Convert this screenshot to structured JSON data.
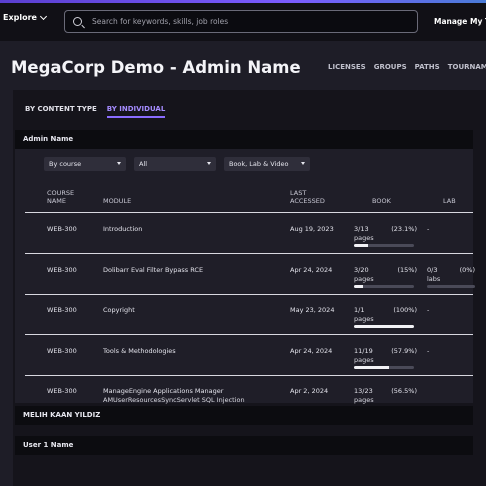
{
  "topbar": {
    "explore_label": "Explore",
    "search_placeholder": "Search for keywords, skills, job roles",
    "manage_label": "Manage My Team"
  },
  "page": {
    "title": "MegaCorp Demo - Admin Name",
    "nav": [
      "LICENSES",
      "GROUPS",
      "PATHS",
      "TOURNAMENTS"
    ]
  },
  "tabs": [
    {
      "label": "BY CONTENT TYPE",
      "active": false
    },
    {
      "label": "BY INDIVIDUAL",
      "active": true
    }
  ],
  "users": [
    {
      "name": "Admin Name",
      "expanded": true
    },
    {
      "name": "MELIH KAAN YILDIZ",
      "expanded": false
    },
    {
      "name": "User 1 Name",
      "expanded": false
    }
  ],
  "filters": [
    {
      "label": "By course"
    },
    {
      "label": "All"
    },
    {
      "label": "Book, Lab & Video"
    }
  ],
  "table": {
    "headers": {
      "course_name": "COURSE NAME",
      "module": "MODULE",
      "last_accessed": "LAST ACCESSED",
      "book": "BOOK",
      "lab": "LAB"
    },
    "rows": [
      {
        "course": "WEB-300",
        "module": "Introduction",
        "module_2": "",
        "accessed": "Aug 19, 2023",
        "book_count": "3/13",
        "book_pct": "(23.1%)",
        "book_unit": "pages",
        "book_fraction": 0.231,
        "lab_count": "-",
        "lab_pct": "",
        "lab_unit": "",
        "lab_fraction": null
      },
      {
        "course": "WEB-300",
        "module": "Dolibarr Eval Filter Bypass RCE",
        "module_2": "",
        "accessed": "Apr 24, 2024",
        "book_count": "3/20",
        "book_pct": "(15%)",
        "book_unit": "pages",
        "book_fraction": 0.15,
        "lab_count": "0/3",
        "lab_pct": "(0%)",
        "lab_unit": "labs",
        "lab_fraction": 0
      },
      {
        "course": "WEB-300",
        "module": "Copyright",
        "module_2": "",
        "accessed": "May 23, 2024",
        "book_count": "1/1",
        "book_pct": "(100%)",
        "book_unit": "pages",
        "book_fraction": 1.0,
        "lab_count": "-",
        "lab_pct": "",
        "lab_unit": "",
        "lab_fraction": null
      },
      {
        "course": "WEB-300",
        "module": "Tools & Methodologies",
        "module_2": "",
        "accessed": "Apr 24, 2024",
        "book_count": "11/19",
        "book_pct": "(57.9%)",
        "book_unit": "pages",
        "book_fraction": 0.579,
        "lab_count": "-",
        "lab_pct": "",
        "lab_unit": "",
        "lab_fraction": null
      },
      {
        "course": "WEB-300",
        "module": "ManageEngine Applications Manager",
        "module_2": "AMUserResourcesSyncServlet SQL Injection",
        "accessed": "Apr 2, 2024",
        "book_count": "13/23",
        "book_pct": "(56.5%)",
        "book_unit": "pages",
        "book_fraction": 0.565,
        "lab_count": "",
        "lab_pct": "",
        "lab_unit": "",
        "lab_fraction": null
      }
    ]
  },
  "colors": {
    "accent": "#8a6cff",
    "background": "#1e1d27",
    "panel": "#15141b",
    "topbar": "#111016"
  }
}
